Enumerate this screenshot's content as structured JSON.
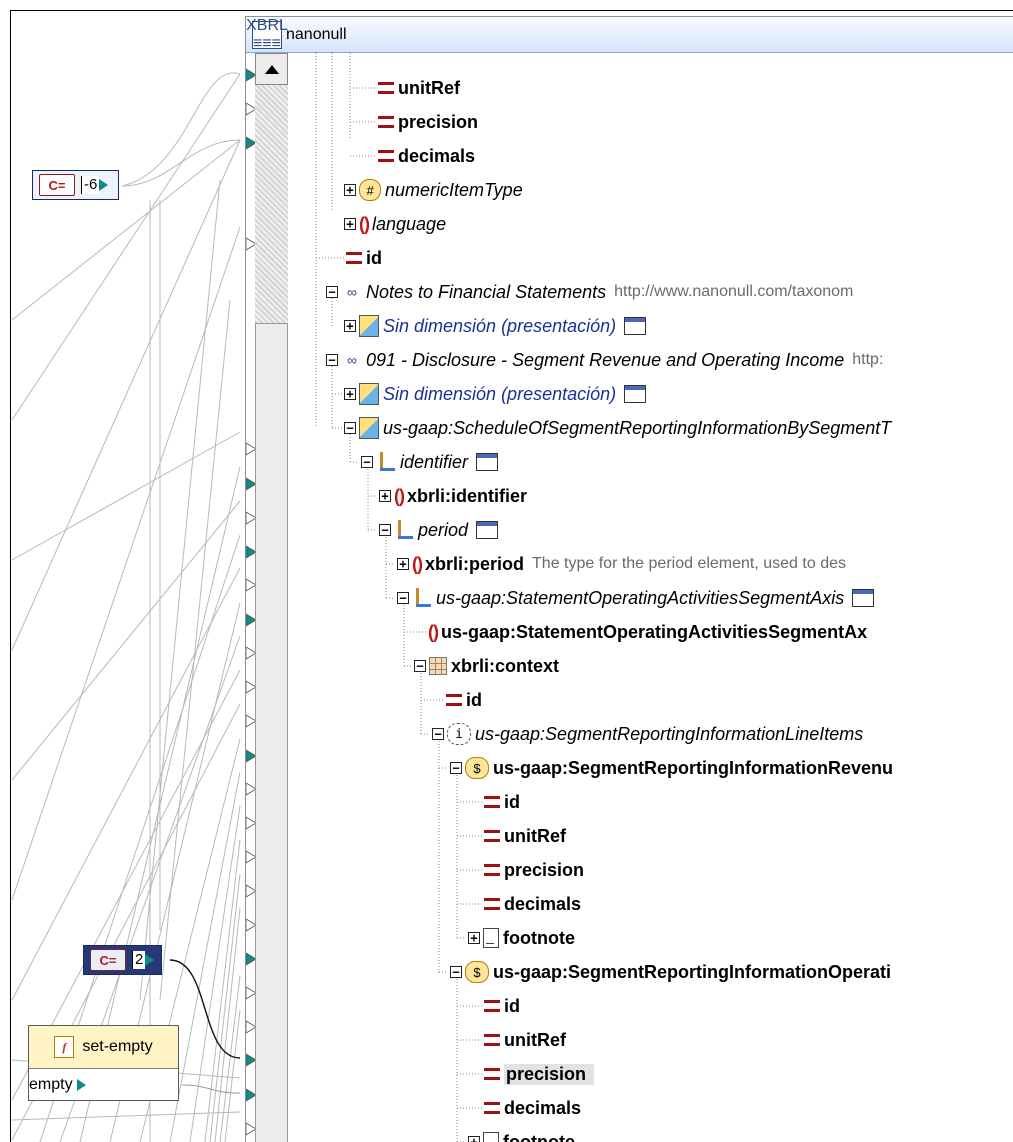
{
  "constants": [
    {
      "tag": "C=",
      "value": "-6",
      "style": "light"
    },
    {
      "tag": "C=",
      "value": "2",
      "style": "dark"
    }
  ],
  "function_node": {
    "name": "set-empty",
    "output": "empty"
  },
  "component": {
    "title": "nanonull",
    "title_icon": "XBRL"
  },
  "tree": [
    {
      "label": "unitRef",
      "kind": "attr"
    },
    {
      "label": "precision",
      "kind": "attr"
    },
    {
      "label": "decimals",
      "kind": "attr"
    },
    {
      "label": "numericItemType",
      "kind": "type"
    },
    {
      "label": "language",
      "kind": "elem-i"
    },
    {
      "label": "id",
      "kind": "attr"
    },
    {
      "label": "Notes to Financial Statements",
      "desc": "http://www.nanonull.com/taxonom",
      "kind": "notes"
    },
    {
      "label": "Sin dimensión (presentación)",
      "kind": "cube"
    },
    {
      "label": "091 - Disclosure - Segment Revenue and Operating Income",
      "desc": "http:",
      "kind": "notes"
    },
    {
      "label": "Sin dimensión (presentación)",
      "kind": "cube"
    },
    {
      "label": "us-gaap:ScheduleOfSegmentReportingInformationBySegmentT",
      "kind": "cube-plain"
    },
    {
      "label": "identifier",
      "kind": "axis"
    },
    {
      "label": "xbrli:identifier",
      "kind": "elem"
    },
    {
      "label": "period",
      "kind": "axis"
    },
    {
      "label": "xbrli:period",
      "desc": "The type for the period element, used to des",
      "kind": "elem"
    },
    {
      "label": "us-gaap:StatementOperatingActivitiesSegmentAxis",
      "kind": "axis"
    },
    {
      "label": "us-gaap:StatementOperatingActivitiesSegmentAx",
      "kind": "elem"
    },
    {
      "label": "xbrli:context",
      "kind": "grid"
    },
    {
      "label": "id",
      "kind": "attr"
    },
    {
      "label": "us-gaap:SegmentReportingInformationLineItems",
      "kind": "info"
    },
    {
      "label": "us-gaap:SegmentReportingInformationRevenu",
      "kind": "dollar"
    },
    {
      "label": "id",
      "kind": "attr"
    },
    {
      "label": "unitRef",
      "kind": "attr"
    },
    {
      "label": "precision",
      "kind": "attr"
    },
    {
      "label": "decimals",
      "kind": "attr"
    },
    {
      "label": "footnote",
      "kind": "doc"
    },
    {
      "label": "us-gaap:SegmentReportingInformationOperati",
      "kind": "dollar"
    },
    {
      "label": "id",
      "kind": "attr"
    },
    {
      "label": "unitRef",
      "kind": "attr"
    },
    {
      "label": "precision",
      "kind": "attr",
      "selected": true
    },
    {
      "label": "decimals",
      "kind": "attr"
    },
    {
      "label": "footnote",
      "kind": "doc"
    }
  ]
}
